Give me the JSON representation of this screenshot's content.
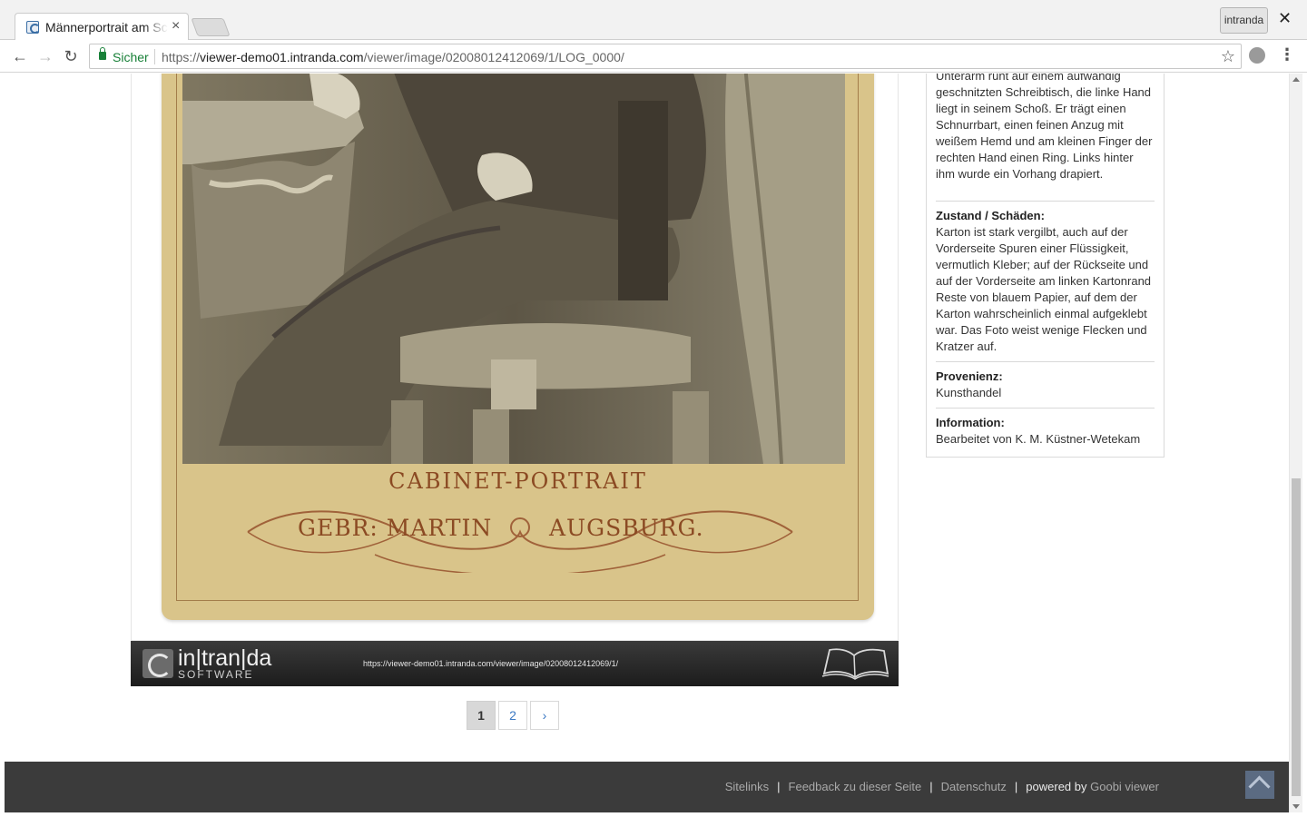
{
  "browser": {
    "tab_title": "Männerportrait am Schreibtisch",
    "profile_label": "intranda",
    "secure_label": "Sicher",
    "url_scheme": "https://",
    "url_host": "viewer-demo01.intranda.com",
    "url_path": "/viewer/image/02008012412069/1/LOG_0000/"
  },
  "photo_card": {
    "title": "CABINET-PORTRAIT",
    "studio": "GEBR: MARTIN",
    "city": "AUGSBURG."
  },
  "viewer_footer": {
    "logo_text": "in|tran|da",
    "logo_sub": "SOFTWARE",
    "url": "https://viewer-demo01.intranda.com/viewer/image/02008012412069/1/"
  },
  "pagination": {
    "pages": [
      "1",
      "2"
    ],
    "current": "1",
    "next": "›"
  },
  "metadata": {
    "description_tail": "Unterarm ruht auf einem aufwändig geschnitzten Schreibtisch, die linke Hand liegt in seinem Schoß. Er trägt einen Schnurrbart, einen feinen Anzug mit weißem Hemd und am kleinen Finger der rechten Hand einen Ring. Links hinter ihm wurde ein Vorhang drapiert.",
    "condition_label": "Zustand / Schäden:",
    "condition_text": "Karton ist stark vergilbt, auch auf der Vorderseite Spuren einer Flüssigkeit, vermutlich Kleber; auf der Rückseite und auf der Vorderseite am linken Kartonrand Reste von blauem Papier, auf dem der Karton wahrscheinlich einmal aufgeklebt war. Das Foto weist wenige Flecken und Kratzer auf.",
    "provenance_label": "Provenienz:",
    "provenance_text": "Kunsthandel",
    "information_label": "Information:",
    "information_text": "Bearbeitet von K. M. Küstner-Wetekam"
  },
  "footer": {
    "sitelinks": "Sitelinks",
    "feedback": "Feedback zu dieser Seite",
    "privacy": "Datenschutz",
    "powered_by": "powered by",
    "goobi": "Goobi viewer",
    "separator": "|"
  },
  "colors": {
    "link": "#3a78c3",
    "secure_green": "#188038",
    "footer_bg": "#3b3b3b",
    "card_ink": "#8b4a23"
  }
}
